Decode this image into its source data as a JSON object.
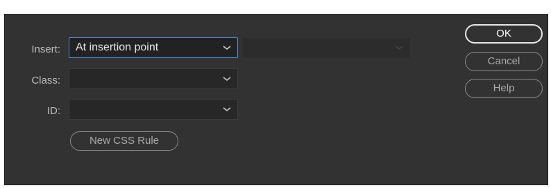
{
  "form": {
    "insert_label": "Insert:",
    "insert_value": "At insertion point",
    "class_label": "Class:",
    "class_value": "",
    "id_label": "ID:",
    "id_value": "",
    "new_css_rule_label": "New CSS Rule"
  },
  "buttons": {
    "ok": "OK",
    "cancel": "Cancel",
    "help": "Help"
  },
  "colors": {
    "dialog_bg": "#323232",
    "focus_border": "#5a8fd6",
    "primary_border": "#e8e8e8"
  },
  "icons": {
    "dropdown": "chevron-down-icon"
  }
}
